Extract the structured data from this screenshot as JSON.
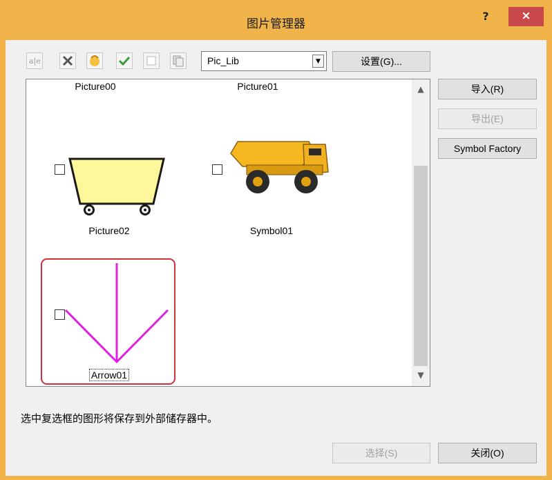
{
  "window": {
    "title": "图片管理器",
    "help_label": "?",
    "close_label": "×"
  },
  "toolbar": {
    "icons": [
      "rename-icon",
      "delete-icon",
      "paste-icon",
      "check-all-icon",
      "uncheck-all-icon",
      "copy-icon"
    ],
    "library_combo": {
      "value": "Pic_Lib"
    },
    "settings_label": "设置(G)..."
  },
  "pictures": [
    {
      "label": "Picture00"
    },
    {
      "label": "Picture01"
    },
    {
      "label": "Picture02"
    },
    {
      "label": "Symbol01"
    },
    {
      "label": "Arrow01"
    }
  ],
  "side_buttons": {
    "import_label": "导入(R)",
    "export_label": "导出(E)",
    "symbol_factory_label": "Symbol Factory"
  },
  "status_text": "选中复选框的图形将保存到外部储存器中。",
  "footer": {
    "select_label": "选择(S)",
    "close_label": "关闭(O)"
  },
  "colors": {
    "title_bar": "#f0b44a",
    "close_button": "#c9494b",
    "selection_frame": "#d0303a",
    "arrow": "#e020e0"
  }
}
